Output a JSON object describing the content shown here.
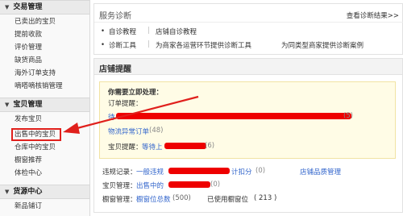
{
  "sidebar": {
    "sections": [
      {
        "title": "交易管理",
        "items": [
          "已卖出的宝贝",
          "提前收款",
          "评价管理",
          "缺货商品",
          "海外订单支持",
          "嘀嗒嘀核销管理"
        ]
      },
      {
        "title": "宝贝管理",
        "items": [
          "发布宝贝",
          "出售中的宝贝",
          "仓库中的宝贝",
          "橱窗推荐",
          "体检中心"
        ]
      },
      {
        "title": "货源中心",
        "items": [
          "新品铺订"
        ]
      }
    ],
    "highlighted_item": "出售中的宝贝"
  },
  "service": {
    "title": "服务诊断",
    "more": "查看诊断结果>>",
    "links": [
      "自诊教程",
      "店铺自诊教程",
      "诊断工具",
      "为商家各运营环节提供诊断工具",
      "为同类型商家提供诊断案例"
    ]
  },
  "store": {
    "title": "店铺提醒",
    "alert_title": "你需要立即处理：",
    "order_label": "订单提醒：",
    "order_prefix": "待",
    "order_count_1": "(5)",
    "logistics_link": "物流异常订单",
    "logistics_count": "(48)",
    "item_label": "宝贝提醒：",
    "item_link": "等待上",
    "item_count": "(6)",
    "violation_label": "违规记录：",
    "violation_link": "一般违规",
    "violation_mid": "计扣分",
    "violation_count": "(0)",
    "store_quality": "店铺品质管理",
    "item_mgmt_label": "宝贝管理：",
    "item_mgmt_link": "出售中的",
    "item_mgmt_count": "(0)",
    "window_label": "橱窗管理：",
    "window_link": "橱窗位总数",
    "window_count": "(500)",
    "window_used_label": "已使用橱窗位",
    "window_used_count": "( 213 )"
  },
  "colors": {
    "accent_red": "#e0201c",
    "link_blue": "#3366cc",
    "alert_bg": "#fffce6"
  }
}
